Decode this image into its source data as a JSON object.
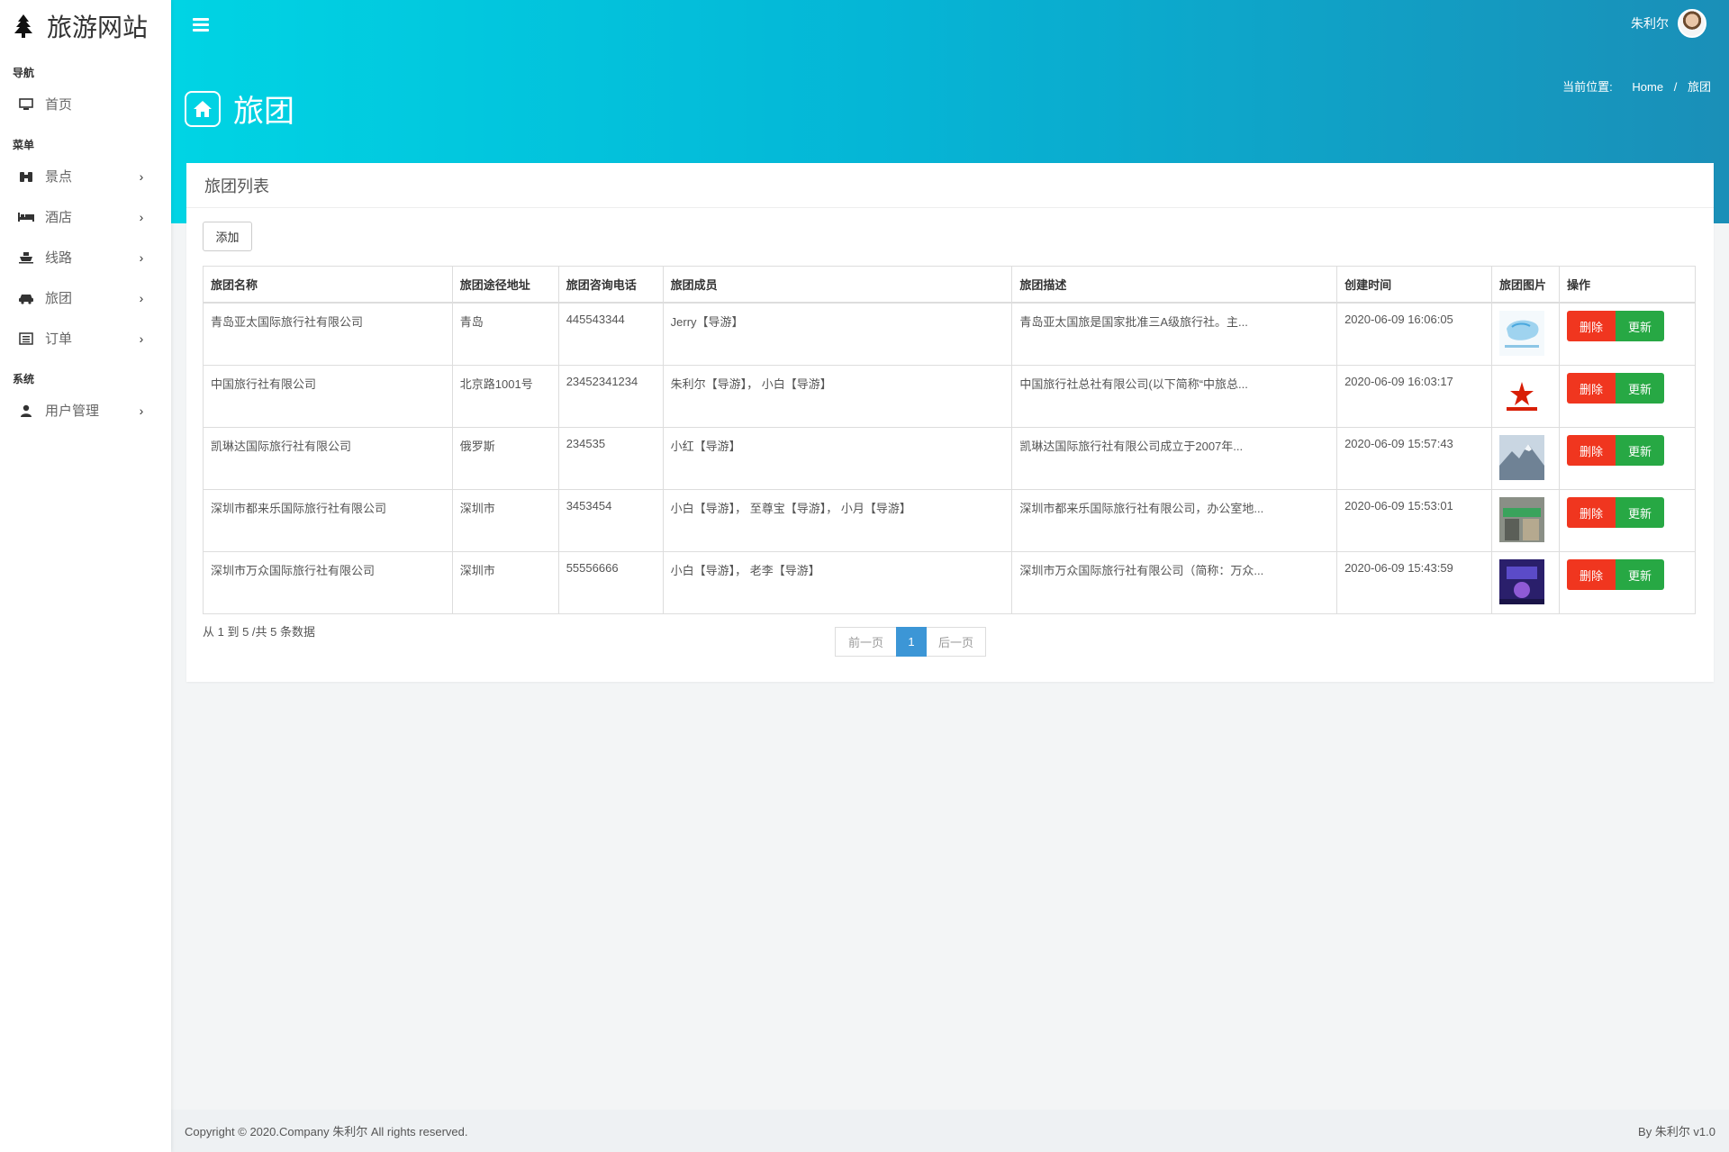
{
  "brand": {
    "title": "旅游网站",
    "icon": "tree-icon"
  },
  "sidebar": {
    "sections": [
      {
        "label": "导航",
        "items": [
          {
            "label": "首页",
            "icon": "desktop-icon",
            "has_submenu": false
          }
        ]
      },
      {
        "label": "菜单",
        "items": [
          {
            "label": "景点",
            "icon": "binoculars-icon",
            "has_submenu": true
          },
          {
            "label": "酒店",
            "icon": "bed-icon",
            "has_submenu": true
          },
          {
            "label": "线路",
            "icon": "ship-icon",
            "has_submenu": true
          },
          {
            "label": "旅团",
            "icon": "car-icon",
            "has_submenu": true
          },
          {
            "label": "订单",
            "icon": "list-alt-icon",
            "has_submenu": true
          }
        ]
      },
      {
        "label": "系统",
        "items": [
          {
            "label": "用户管理",
            "icon": "user-icon",
            "has_submenu": true
          }
        ]
      }
    ]
  },
  "header": {
    "user_name": "朱利尔",
    "page_title": "旅团",
    "breadcrumb": {
      "label": "当前位置:",
      "home": "Home",
      "separator": "/",
      "current": "旅团"
    }
  },
  "card": {
    "title": "旅团列表",
    "add_label": "添加",
    "columns": [
      "旅团名称",
      "旅团途径地址",
      "旅团咨询电话",
      "旅团成员",
      "旅团描述",
      "创建时间",
      "旅团图片",
      "操作"
    ],
    "rows": [
      {
        "name": "青岛亚太国际旅行社有限公司",
        "address": "青岛",
        "phone": "445543344",
        "members": "Jerry【导游】",
        "description": "青岛亚太国旅是国家批准三A级旅行社。主...",
        "created": "2020-06-09 16:06:05",
        "image": "map-logo"
      },
      {
        "name": "中国旅行社有限公司",
        "address": "北京路1001号",
        "phone": "23452341234",
        "members": "朱利尔【导游】， 小白【导游】",
        "description": "中国旅行社总社有限公司(以下简称“中旅总...",
        "created": "2020-06-09 16:03:17",
        "image": "cts-logo"
      },
      {
        "name": "凯琳达国际旅行社有限公司",
        "address": "俄罗斯",
        "phone": "234535",
        "members": "小红【导游】",
        "description": "凯琳达国际旅行社有限公司成立于2007年...",
        "created": "2020-06-09 15:57:43",
        "image": "mountain-photo"
      },
      {
        "name": "深圳市都来乐国际旅行社有限公司",
        "address": "深圳市",
        "phone": "3453454",
        "members": "小白【导游】， 至尊宝【导游】， 小月【导游】",
        "description": "深圳市都来乐国际旅行社有限公司，办公室地...",
        "created": "2020-06-09 15:53:01",
        "image": "storefront-photo"
      },
      {
        "name": "深圳市万众国际旅行社有限公司",
        "address": "深圳市",
        "phone": "55556666",
        "members": "小白【导游】， 老李【导游】",
        "description": "深圳市万众国际旅行社有限公司（简称：万众...",
        "created": "2020-06-09 15:43:59",
        "image": "stage-photo"
      }
    ],
    "delete_label": "删除",
    "update_label": "更新",
    "summary": "从 1 到 5 /共 5 条数据",
    "pagination": {
      "prev": "前一页",
      "current": "1",
      "next": "后一页"
    }
  },
  "footer": {
    "copyright": "Copyright © 2020.Company 朱利尔 All rights reserved.",
    "version": "By 朱利尔 v1.0"
  },
  "colors": {
    "gradient_start": "#00d4e4",
    "gradient_end": "#1a8fb8",
    "delete": "#f0361f",
    "update": "#27a844",
    "page_active": "#3c96d6"
  }
}
